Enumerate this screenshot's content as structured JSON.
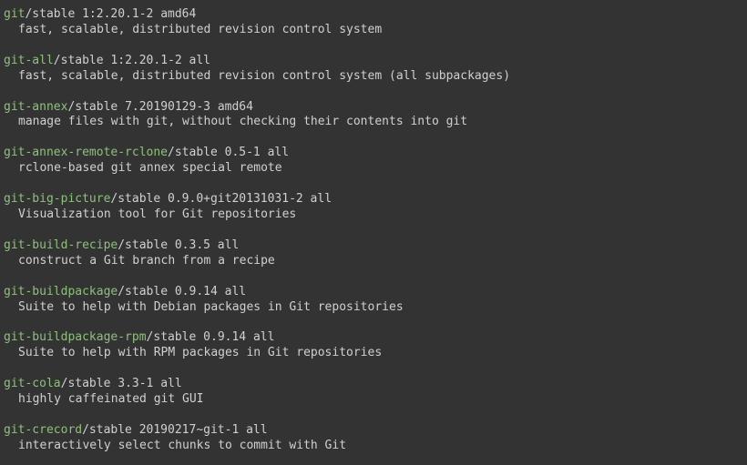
{
  "packages": [
    {
      "name": "git",
      "meta": "/stable 1:2.20.1-2 amd64",
      "desc": "fast, scalable, distributed revision control system"
    },
    {
      "name": "git-all",
      "meta": "/stable 1:2.20.1-2 all",
      "desc": "fast, scalable, distributed revision control system (all subpackages)"
    },
    {
      "name": "git-annex",
      "meta": "/stable 7.20190129-3 amd64",
      "desc": "manage files with git, without checking their contents into git"
    },
    {
      "name": "git-annex-remote-rclone",
      "meta": "/stable 0.5-1 all",
      "desc": "rclone-based git annex special remote"
    },
    {
      "name": "git-big-picture",
      "meta": "/stable 0.9.0+git20131031-2 all",
      "desc": "Visualization tool for Git repositories"
    },
    {
      "name": "git-build-recipe",
      "meta": "/stable 0.3.5 all",
      "desc": "construct a Git branch from a recipe"
    },
    {
      "name": "git-buildpackage",
      "meta": "/stable 0.9.14 all",
      "desc": "Suite to help with Debian packages in Git repositories"
    },
    {
      "name": "git-buildpackage-rpm",
      "meta": "/stable 0.9.14 all",
      "desc": "Suite to help with RPM packages in Git repositories"
    },
    {
      "name": "git-cola",
      "meta": "/stable 3.3-1 all",
      "desc": "highly caffeinated git GUI"
    },
    {
      "name": "git-crecord",
      "meta": "/stable 20190217~git-1 all",
      "desc": "interactively select chunks to commit with Git"
    }
  ]
}
